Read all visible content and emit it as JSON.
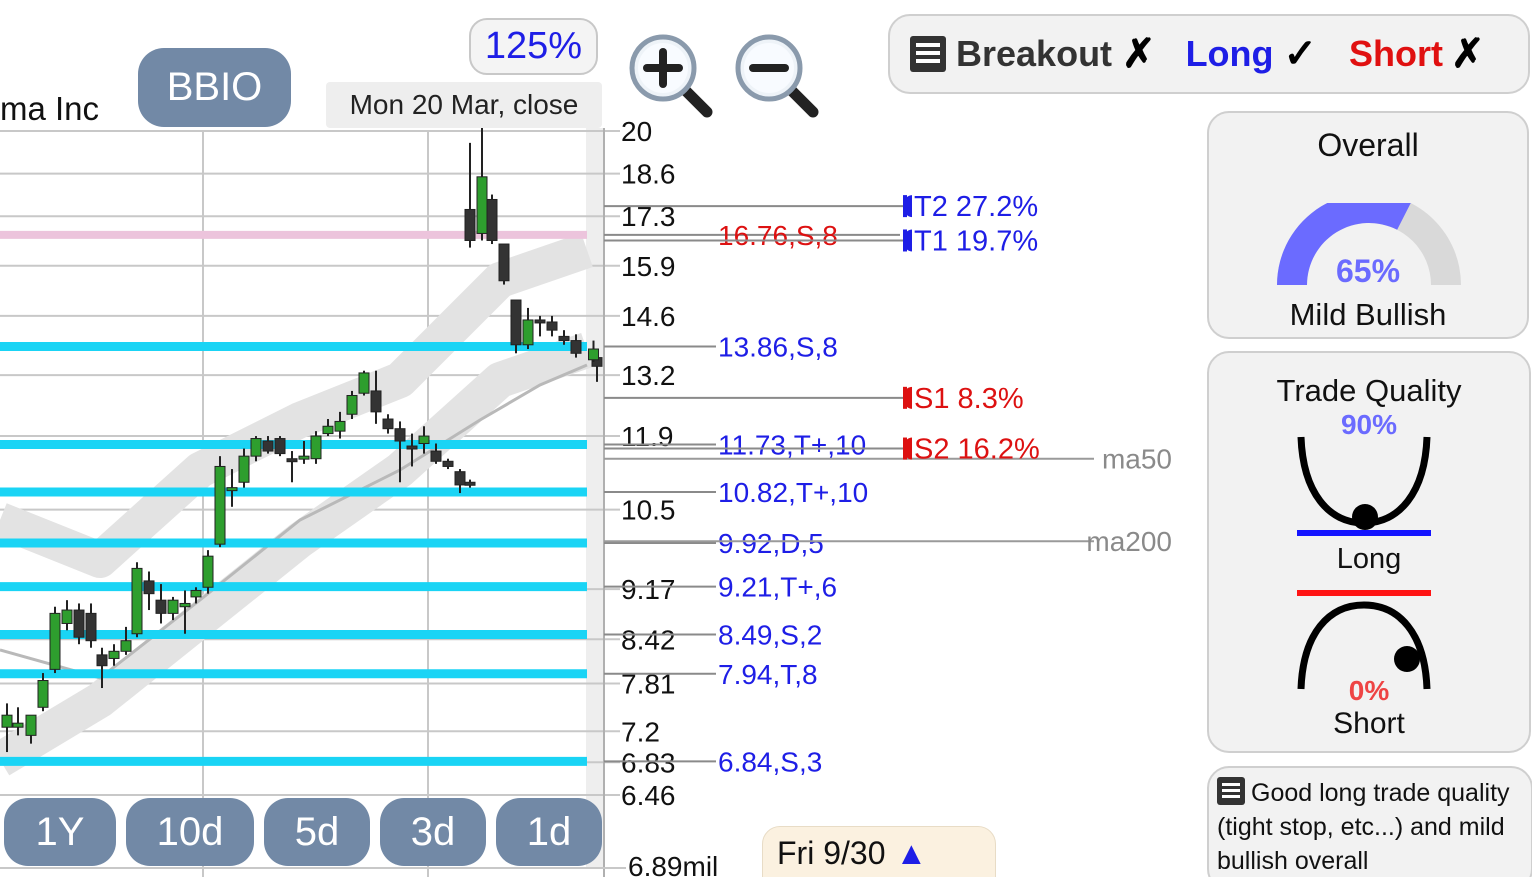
{
  "header": {
    "company_name_fragment": "ma Inc",
    "ticker": "BBIO",
    "zoom_level": "125%",
    "date_label": "Mon 20 Mar, close"
  },
  "signals": {
    "breakout_label": "Breakout",
    "breakout_mark": "✗",
    "long_label": "Long",
    "long_mark": "✓",
    "short_label": "Short",
    "short_mark": "✗",
    "colors": {
      "breakout": "#333333",
      "long": "#1e1ee6",
      "short": "#e01010"
    }
  },
  "overall": {
    "title": "Overall",
    "value_label": "65%",
    "value": 65,
    "sentiment": "Mild Bullish",
    "gauge_color": "#6b6bff"
  },
  "trade_quality": {
    "title": "Trade Quality",
    "long_value_label": "90%",
    "long_label": "Long",
    "short_value_label": "0%",
    "short_label": "Short"
  },
  "note": {
    "text": "Good long trade quality (tight stop, etc...) and mild bullish overall"
  },
  "range_buttons": [
    "1Y",
    "10d",
    "5d",
    "3d",
    "1d"
  ],
  "bottom_tag": {
    "text": "Fri 9/30",
    "arrow": "▲"
  },
  "chart_data": {
    "type": "candlestick",
    "y_scale": "log",
    "ylim": [
      6.3,
      20.0
    ],
    "y_ticks": [
      20,
      18.6,
      17.3,
      15.9,
      14.6,
      13.2,
      11.9,
      10.5,
      9.17,
      8.42,
      7.81,
      7.2,
      6.83,
      6.46
    ],
    "y_tick_labels": [
      "20",
      "18.6",
      "17.3",
      "15.9",
      "14.6",
      "13.2",
      "11.9",
      "10.5",
      "9.17",
      "8.42",
      "7.81",
      "7.2",
      "6.83",
      "6.46"
    ],
    "volume_label": "6.89mil",
    "grid": true,
    "candles": [
      {
        "o": 7.25,
        "h": 7.55,
        "l": 6.95,
        "c": 7.4
      },
      {
        "o": 7.25,
        "h": 7.5,
        "l": 7.15,
        "c": 7.3
      },
      {
        "o": 7.15,
        "h": 7.4,
        "l": 7.05,
        "c": 7.4
      },
      {
        "o": 7.5,
        "h": 7.95,
        "l": 7.45,
        "c": 7.85
      },
      {
        "o": 8.0,
        "h": 8.9,
        "l": 7.95,
        "c": 8.8
      },
      {
        "o": 8.65,
        "h": 9.0,
        "l": 8.55,
        "c": 8.85
      },
      {
        "o": 8.85,
        "h": 8.95,
        "l": 8.35,
        "c": 8.45
      },
      {
        "o": 8.8,
        "h": 8.95,
        "l": 8.3,
        "c": 8.4
      },
      {
        "o": 8.2,
        "h": 8.3,
        "l": 7.75,
        "c": 8.05
      },
      {
        "o": 8.15,
        "h": 8.35,
        "l": 8.05,
        "c": 8.25
      },
      {
        "o": 8.25,
        "h": 8.6,
        "l": 8.2,
        "c": 8.4
      },
      {
        "o": 8.5,
        "h": 9.6,
        "l": 8.45,
        "c": 9.5
      },
      {
        "o": 9.3,
        "h": 9.45,
        "l": 8.85,
        "c": 9.1
      },
      {
        "o": 9.0,
        "h": 9.25,
        "l": 8.65,
        "c": 8.8
      },
      {
        "o": 8.8,
        "h": 9.05,
        "l": 8.7,
        "c": 9.0
      },
      {
        "o": 8.9,
        "h": 9.15,
        "l": 8.5,
        "c": 8.95
      },
      {
        "o": 9.05,
        "h": 9.2,
        "l": 8.95,
        "c": 9.15
      },
      {
        "o": 9.2,
        "h": 9.8,
        "l": 9.1,
        "c": 9.7
      },
      {
        "o": 9.9,
        "h": 11.5,
        "l": 9.85,
        "c": 11.3
      },
      {
        "o": 10.9,
        "h": 11.25,
        "l": 10.55,
        "c": 10.9
      },
      {
        "o": 11.0,
        "h": 11.65,
        "l": 10.9,
        "c": 11.5
      },
      {
        "o": 11.5,
        "h": 11.9,
        "l": 11.4,
        "c": 11.85
      },
      {
        "o": 11.8,
        "h": 11.9,
        "l": 11.55,
        "c": 11.6
      },
      {
        "o": 11.85,
        "h": 11.9,
        "l": 11.5,
        "c": 11.55
      },
      {
        "o": 11.45,
        "h": 11.6,
        "l": 11.0,
        "c": 11.4
      },
      {
        "o": 11.45,
        "h": 11.8,
        "l": 11.35,
        "c": 11.5
      },
      {
        "o": 11.45,
        "h": 12.0,
        "l": 11.35,
        "c": 11.9
      },
      {
        "o": 11.95,
        "h": 12.25,
        "l": 11.9,
        "c": 12.1
      },
      {
        "o": 12.0,
        "h": 12.4,
        "l": 11.85,
        "c": 12.2
      },
      {
        "o": 12.35,
        "h": 12.85,
        "l": 12.25,
        "c": 12.75
      },
      {
        "o": 12.8,
        "h": 13.3,
        "l": 12.75,
        "c": 13.25
      },
      {
        "o": 12.85,
        "h": 13.3,
        "l": 12.15,
        "c": 12.4
      },
      {
        "o": 12.25,
        "h": 12.35,
        "l": 11.95,
        "c": 12.05
      },
      {
        "o": 12.05,
        "h": 12.2,
        "l": 11.0,
        "c": 11.8
      },
      {
        "o": 11.7,
        "h": 11.95,
        "l": 11.3,
        "c": 11.65
      },
      {
        "o": 11.75,
        "h": 12.1,
        "l": 11.55,
        "c": 11.9
      },
      {
        "o": 11.6,
        "h": 11.75,
        "l": 11.35,
        "c": 11.4
      },
      {
        "o": 11.4,
        "h": 11.45,
        "l": 11.25,
        "c": 11.3
      },
      {
        "o": 11.2,
        "h": 11.25,
        "l": 10.8,
        "c": 10.95
      },
      {
        "o": 11.0,
        "h": 11.05,
        "l": 10.9,
        "c": 10.98
      },
      {
        "o": 17.5,
        "h": 19.6,
        "l": 16.4,
        "c": 16.6
      },
      {
        "o": 16.8,
        "h": 20.3,
        "l": 16.6,
        "c": 18.5
      },
      {
        "o": 17.8,
        "h": 17.95,
        "l": 16.5,
        "c": 16.6
      },
      {
        "o": 16.5,
        "h": 16.5,
        "l": 15.4,
        "c": 15.5
      },
      {
        "o": 15.0,
        "h": 15.0,
        "l": 13.7,
        "c": 13.9
      },
      {
        "o": 13.9,
        "h": 14.8,
        "l": 13.8,
        "c": 14.5
      },
      {
        "o": 14.5,
        "h": 14.6,
        "l": 14.1,
        "c": 14.45
      },
      {
        "o": 14.45,
        "h": 14.6,
        "l": 14.1,
        "c": 14.25
      },
      {
        "o": 14.1,
        "h": 14.25,
        "l": 13.9,
        "c": 14.0
      },
      {
        "o": 14.0,
        "h": 14.15,
        "l": 13.6,
        "c": 13.7
      },
      {
        "o": 13.6,
        "h": 13.7,
        "l": 13.05,
        "c": 13.4
      },
      {
        "o": 13.55,
        "h": 14.0,
        "l": 13.5,
        "c": 13.8
      }
    ],
    "support_resistance_lines": [
      {
        "value": 13.86,
        "label": "13.86,S,8",
        "color": "#1e1ee6"
      },
      {
        "value": 11.73,
        "label": "11.73,T+,10",
        "color": "#1e1ee6"
      },
      {
        "value": 10.82,
        "label": "10.82,T+,10",
        "color": "#1e1ee6"
      },
      {
        "value": 9.92,
        "label": "9.92,D,5",
        "color": "#1e1ee6"
      },
      {
        "value": 9.21,
        "label": "9.21,T+,6",
        "color": "#1e1ee6"
      },
      {
        "value": 8.49,
        "label": "8.49,S,2",
        "color": "#1e1ee6"
      },
      {
        "value": 7.94,
        "label": "7.94,T,8",
        "color": "#1e1ee6"
      },
      {
        "value": 6.84,
        "label": "6.84,S,3",
        "color": "#1e1ee6"
      }
    ],
    "resistance_line": {
      "value": 16.76,
      "label": "16.76,S,8",
      "color": "#dd1111"
    },
    "targets": [
      {
        "label": "T2 27.2%",
        "value": 17.6,
        "color": "#1e1ee6"
      },
      {
        "label": "T1 19.7%",
        "value": 16.6,
        "color": "#1e1ee6"
      },
      {
        "label": "S1 8.3%",
        "value": 12.7,
        "color": "#dd1111"
      },
      {
        "label": "S2 16.2%",
        "value": 11.65,
        "color": "#dd1111"
      }
    ],
    "moving_averages": [
      {
        "name": "ma50",
        "value": 11.45
      },
      {
        "name": "ma200",
        "value": 9.95
      }
    ]
  }
}
